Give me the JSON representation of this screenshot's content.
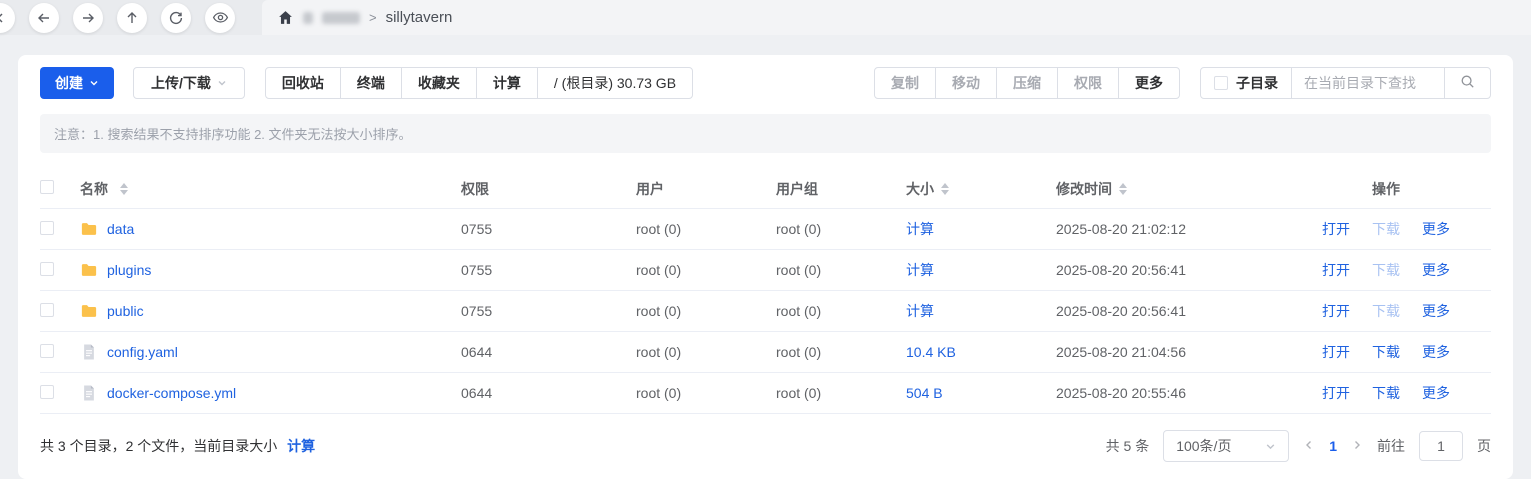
{
  "topbar": {
    "nav_icons": [
      "chevron-left",
      "arrow-left",
      "arrow-right",
      "arrow-up",
      "refresh",
      "eye"
    ],
    "breadcrumb": {
      "separator": ">",
      "current": "sillytavern"
    }
  },
  "toolbar": {
    "create_label": "创建",
    "upload_download_label": "上传/下载",
    "recycle_label": "回收站",
    "terminal_label": "终端",
    "favorites_label": "收藏夹",
    "calculate_label": "计算",
    "root_info": "/ (根目录) 30.73 GB",
    "copy_label": "复制",
    "move_label": "移动",
    "compress_label": "压缩",
    "permission_label": "权限",
    "more_label": "更多",
    "subdir_label": "子目录",
    "search_placeholder": "在当前目录下查找"
  },
  "notice": "注意：1. 搜索结果不支持排序功能 2. 文件夹无法按大小排序。",
  "table": {
    "headers": {
      "name": "名称",
      "perm": "权限",
      "user": "用户",
      "group": "用户组",
      "size": "大小",
      "mtime": "修改时间",
      "action": "操作"
    },
    "action_labels": {
      "open": "打开",
      "download": "下载",
      "more": "更多"
    },
    "rows": [
      {
        "name": "data",
        "type": "folder",
        "perm": "0755",
        "user": "root (0)",
        "group": "root (0)",
        "size": "计算",
        "mtime": "2025-08-20 21:02:12",
        "download_enabled": false
      },
      {
        "name": "plugins",
        "type": "folder",
        "perm": "0755",
        "user": "root (0)",
        "group": "root (0)",
        "size": "计算",
        "mtime": "2025-08-20 20:56:41",
        "download_enabled": false
      },
      {
        "name": "public",
        "type": "folder",
        "perm": "0755",
        "user": "root (0)",
        "group": "root (0)",
        "size": "计算",
        "mtime": "2025-08-20 20:56:41",
        "download_enabled": false
      },
      {
        "name": "config.yaml",
        "type": "file",
        "perm": "0644",
        "user": "root (0)",
        "group": "root (0)",
        "size": "10.4 KB",
        "mtime": "2025-08-20 21:04:56",
        "download_enabled": true
      },
      {
        "name": "docker-compose.yml",
        "type": "file",
        "perm": "0644",
        "user": "root (0)",
        "group": "root (0)",
        "size": "504 B",
        "mtime": "2025-08-20 20:55:46",
        "download_enabled": true
      }
    ]
  },
  "footer": {
    "summary_prefix": "共 3 个目录，2 个文件，当前目录大小",
    "summary_link": "计算",
    "total": "共 5 条",
    "page_size": "100条/页",
    "current_page": "1",
    "goto_label": "前往",
    "goto_value": "1",
    "page_suffix": "页"
  },
  "colors": {
    "primary": "#1a5eeb",
    "link": "#1f62e0",
    "link_disabled": "#a8c2f2",
    "folder_icon": "#fbc14b",
    "notice_bg": "#f4f5f7",
    "page_bg": "#eef0f3"
  }
}
